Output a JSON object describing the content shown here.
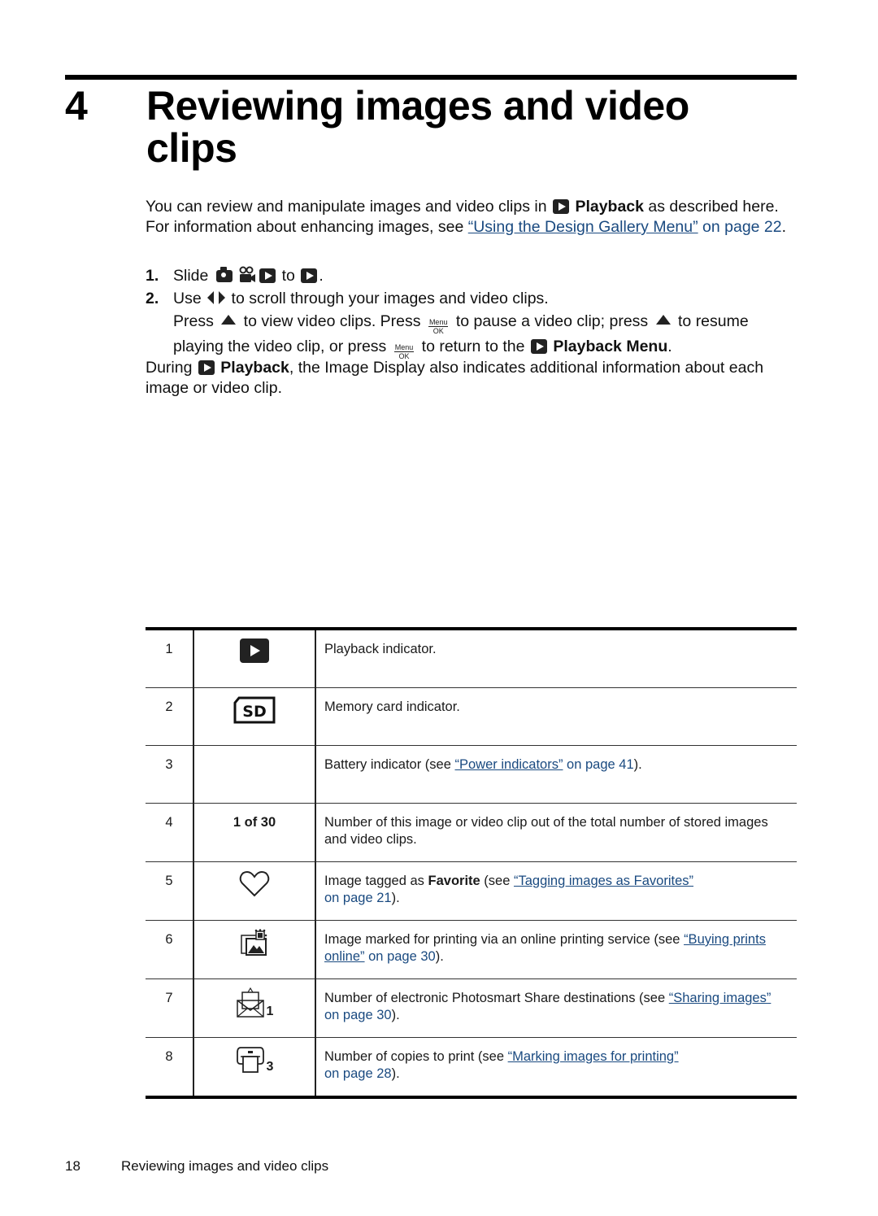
{
  "chapter": {
    "number": "4",
    "title": "Reviewing images and video clips"
  },
  "intro": {
    "text_1": "You can review and manipulate images and video clips in ",
    "playback_icon": "playback-icon",
    "playback_label": "Playback",
    "text_2": " as described here. For information about enhancing images, see ",
    "link_text": "“Using the Design Gallery Menu”",
    "link_page": " on page 22",
    "text_3": "."
  },
  "steps": [
    {
      "number": "1.",
      "text_before": "Slide ",
      "icons": [
        "camera-icon",
        "video-icon",
        "playback-icon"
      ],
      "text_mid": " to ",
      "text_after": "."
    },
    {
      "number": "2.",
      "text_before": "Use ",
      "arrows_icon": "left-right-arrows-icon",
      "text_after": " to scroll through your images and video clips.",
      "line2_a": "Press ",
      "line2_b": " to view video clips. Press ",
      "line2_c": " to pause a video clip; press ",
      "line2_d": " to resume",
      "line3_a": "playing the video clip, or press ",
      "line3_b": " to return to the ",
      "line3_bold": "Playback Menu",
      "line3_c": ".",
      "menu_ok_top": "Menu",
      "menu_ok_bottom": "OK"
    }
  ],
  "during": {
    "text_1": "During ",
    "bold": "Playback",
    "text_2": ", the Image Display also indicates additional information about each image or video clip."
  },
  "table": {
    "rows": [
      {
        "num": "1",
        "icon": "playback-indicator-icon",
        "desc": "Playback indicator."
      },
      {
        "num": "2",
        "icon": "sd-card-icon",
        "desc": "Memory card indicator."
      },
      {
        "num": "3",
        "icon": "",
        "desc_before": "Battery indicator (see ",
        "link": "“Power indicators”",
        "link_page": " on page 41",
        "desc_after": ")."
      },
      {
        "num": "4",
        "label": "1 of 30",
        "desc": "Number of this image or video clip out of the total number of stored images and video clips."
      },
      {
        "num": "5",
        "icon": "heart-icon",
        "desc_before": "Image tagged as ",
        "bold": "Favorite",
        "desc_mid": " (see ",
        "link": "“Tagging images as Favorites”",
        "link_page": " on page 21",
        "desc_after": ")."
      },
      {
        "num": "6",
        "icon": "online-print-icon",
        "desc_before": "Image marked for printing via an online printing service (see ",
        "link": "“Buying prints online”",
        "link_page": " on page 30",
        "desc_after": ")."
      },
      {
        "num": "7",
        "icon": "share-envelope-icon",
        "icon_count": "1",
        "desc_before": "Number of electronic Photosmart Share destinations (see ",
        "link": "“Sharing images”",
        "link_page": " on page 30",
        "desc_after": ")."
      },
      {
        "num": "8",
        "icon": "printer-icon",
        "icon_count": "3",
        "desc_before": "Number of copies to print (see ",
        "link": "“Marking images for printing”",
        "link_page": " on page 28",
        "desc_after": ")."
      }
    ]
  },
  "footer": {
    "page_number": "18",
    "title": "Reviewing images and video clips"
  },
  "colors": {
    "link": "#1a4a80",
    "text": "#111111",
    "rule": "#000000"
  }
}
